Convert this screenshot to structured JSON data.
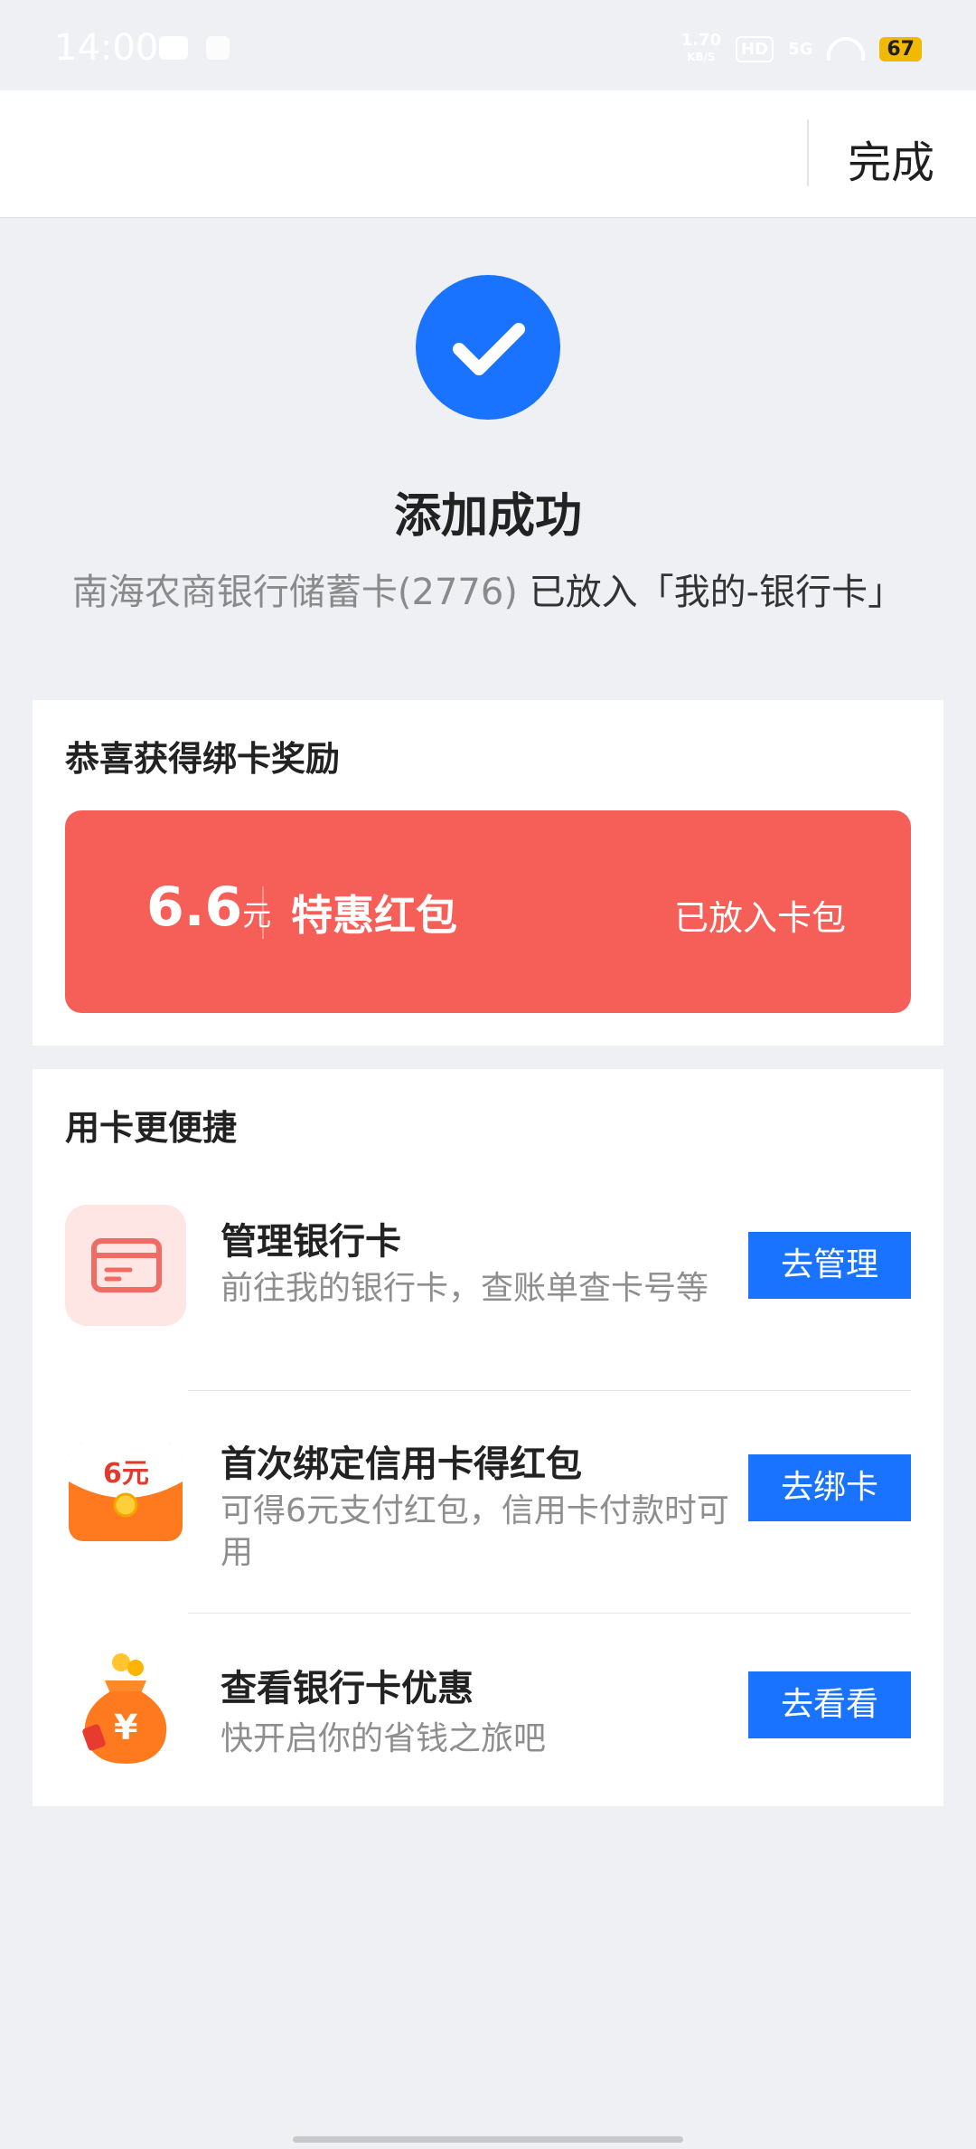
{
  "status_bar": {
    "time": "14:00",
    "net_speed_value": "1.70",
    "net_speed_unit": "KB/S",
    "hd": "HD",
    "signal": "5G",
    "battery": "67"
  },
  "header": {
    "done_label": "完成"
  },
  "result": {
    "title": "添加成功",
    "card_name": "南海农商银行储蓄卡(2776)",
    "placed_text": "已放入「我的-银行卡」"
  },
  "reward": {
    "title": "恭喜获得绑卡奖励",
    "amount": "6.6",
    "unit": "元",
    "name": "特惠红包",
    "status": "已放入卡包",
    "color": "#f55f58"
  },
  "quick": {
    "title": "用卡更便捷",
    "items": [
      {
        "title": "管理银行卡",
        "desc": "前往我的银行卡，查账单查卡号等",
        "button": "去管理",
        "icon": "bank-card-icon"
      },
      {
        "title": "首次绑定信用卡得红包",
        "desc": "可得6元支付红包，信用卡付款时可用",
        "button": "去绑卡",
        "icon": "red-envelope-icon",
        "icon_text": "6元"
      },
      {
        "title": "查看银行卡优惠",
        "desc": "快开启你的省钱之旅吧",
        "button": "去看看",
        "icon": "money-bag-icon",
        "icon_text": "¥"
      }
    ]
  },
  "colors": {
    "accent": "#1a73ff",
    "background": "#eef0f4"
  }
}
